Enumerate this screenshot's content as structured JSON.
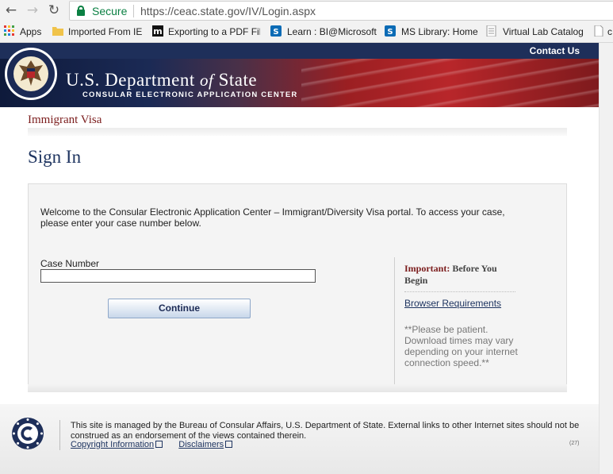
{
  "browser": {
    "nav": {
      "back": "←",
      "forward": "→",
      "reload": "↻"
    },
    "secure_label": "Secure",
    "url": "https://ceac.state.gov/IV/Login.aspx",
    "bookmarks": [
      {
        "label": "Apps",
        "icon": "apps-grid-icon"
      },
      {
        "label": "Imported From IE",
        "icon": "folder-icon"
      },
      {
        "label": "Exporting to a PDF Fil",
        "icon": "m-logo-icon"
      },
      {
        "label": "Learn : BI@Microsoft",
        "icon": "sharepoint-icon"
      },
      {
        "label": "MS Library: Home",
        "icon": "sharepoint-icon"
      },
      {
        "label": "Virtual Lab Catalog",
        "icon": "page-icon"
      },
      {
        "label": "c",
        "icon": "page-icon"
      }
    ]
  },
  "header": {
    "contact": "Contact Us",
    "dept_part1": "U.S. Department ",
    "dept_of": "of",
    "dept_part2": " State",
    "subtitle": "CONSULAR ELECTRONIC APPLICATION CENTER"
  },
  "main": {
    "section": "Immigrant Visa",
    "page_title": "Sign In",
    "welcome": "Welcome to the Consular Electronic Application Center – Immigrant/Diversity Visa portal. To access your case, please enter your case number below.",
    "case_label": "Case Number",
    "case_value": "",
    "continue": "Continue"
  },
  "sidebar": {
    "important_label": "Important:",
    "important_rest": " Before You Begin",
    "browser_link": "Browser Requirements",
    "patience": "**Please be patient. Download times may vary depending on your internet connection speed.**"
  },
  "footer": {
    "text": "This site is managed by the Bureau of Consular Affairs, U.S. Department of State. External links to other Internet sites should not be construed as an endorsement of the views contained therein.",
    "copyright": "Copyright Information",
    "disclaimers": "Disclaimers",
    "code": "(27)"
  },
  "colors": {
    "navy": "#1e2f5a",
    "maroon": "#7b1c1c",
    "secure_green": "#0b8043"
  }
}
